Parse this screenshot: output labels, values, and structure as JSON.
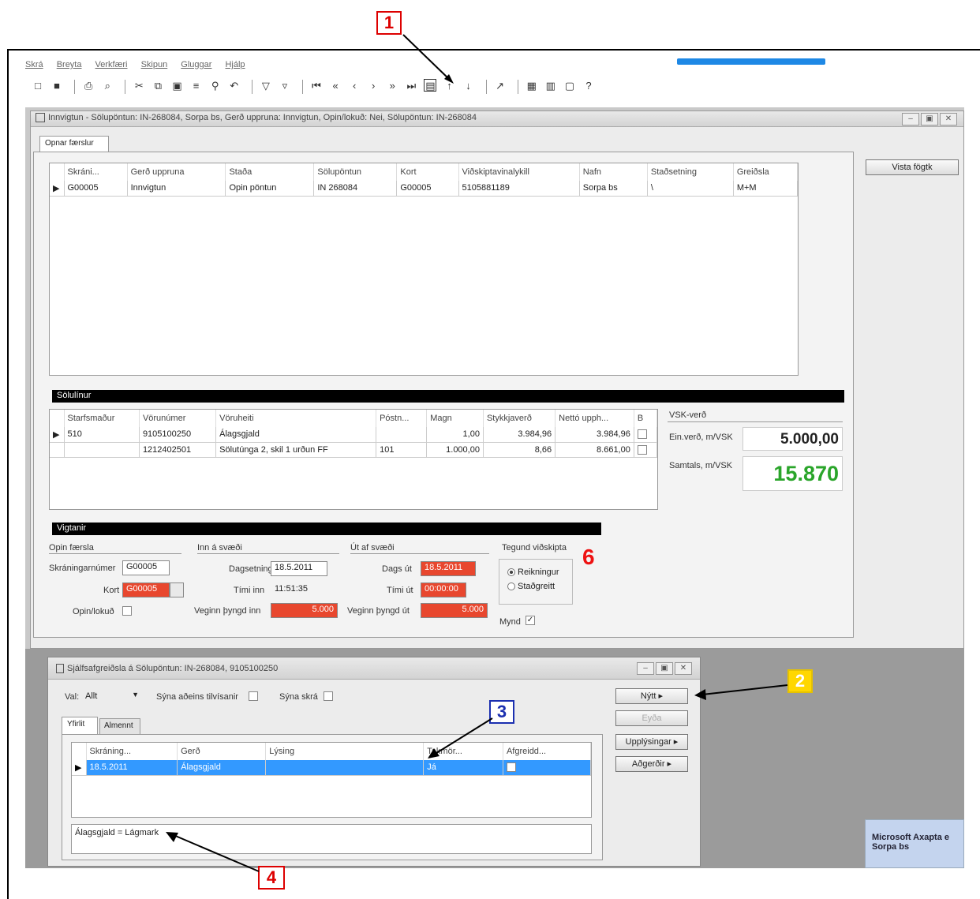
{
  "callouts": {
    "c1": "1",
    "c2": "2",
    "c3": "3",
    "c4": "4",
    "c6": "6"
  },
  "menu": [
    "Skrá",
    "Breyta",
    "Verkfæri",
    "Skipun",
    "Gluggar",
    "Hjálp"
  ],
  "main_window": {
    "title": "Innvigtun - Sölupöntun: IN-268084, Sorpa bs, Gerð uppruna: Innvigtun, Opin/lokuð: Nei, Sölupöntun: IN-268084",
    "tab": "Opnar færslur",
    "side_button": "Vista fögtk",
    "orders": {
      "headers": [
        "Skráni...",
        "Gerð uppruna",
        "Staða",
        "Sölupöntun",
        "Kort",
        "Viðskiptavinalykill",
        "Nafn",
        "Staðsetning",
        "Greiðsla"
      ],
      "rows": [
        [
          "G00005",
          "Innvigtun",
          "Opin pöntun",
          "IN 268084",
          "G00005",
          "5105881189",
          "Sorpa bs",
          "\\",
          "M+M"
        ]
      ]
    },
    "lines_section": {
      "title": "Sölulínur",
      "headers": [
        "Starfsmaður",
        "Vörunúmer",
        "Vöruheiti",
        "Póstn...",
        "Magn",
        "Stykkjaverð",
        "Nettó upph...",
        "B"
      ],
      "rows": [
        [
          "510",
          "9105100250",
          "Álagsgjald",
          "",
          "1,00",
          "3.984,96",
          "3.984,96"
        ],
        [
          "",
          "1212402501",
          "Sölutúnga 2, skil 1 urðun FF",
          "101",
          "1.000,00",
          "8,66",
          "8.661,00"
        ]
      ],
      "vat_label": "VSK-verð",
      "unit_price_label": "Ein.verð, m/VSK",
      "unit_price": "5.000,00",
      "total_label": "Samtals, m/VSK",
      "total": "15.870"
    },
    "weighing": {
      "title": "Vigtanir",
      "g1_title": "Opin færsla",
      "license_label": "Skráningarnúmer",
      "license": "G00005",
      "card_label": "Kort",
      "card": "G00005",
      "open_label": "Opin/lokuð",
      "g2_title": "Inn á svæði",
      "date_in_label": "Dagsetning",
      "date_in": "18.5.2011",
      "time_in_label": "Tími inn",
      "time_in": "11:51:35",
      "weight_in_label": "Veginn þyngd inn",
      "weight_in": "5.000",
      "g3_title": "Út af svæði",
      "date_out_label": "Dags út",
      "date_out": "18.5.2011",
      "time_out_label": "Tími út",
      "time_out": "00:00:00",
      "weight_out_label": "Veginn þyngd út",
      "weight_out": "5.000",
      "g4_title": "Tegund viðskipta",
      "radio1": "Reikningur",
      "radio2": "Staðgreitt",
      "photo_label": "Mynd"
    }
  },
  "sub_window": {
    "title": "Sjálfsafgreiðsla á Sölupöntun: IN-268084, 9105100250",
    "view_label": "Val:",
    "view_value": "Allt",
    "show_active_label": "Sýna aðeins tilvísanir",
    "show_all_label": "Sýna skrá",
    "tabs": [
      "Yfirlit",
      "Almennt"
    ],
    "headers": [
      "Skráning...",
      "Gerð",
      "Lýsing",
      "Takmör...",
      "Afgreidd..."
    ],
    "row": [
      "18.5.2011",
      "Álagsgjald",
      "",
      "Já",
      ""
    ],
    "note": "Álagsgjald = Lágmark",
    "buttons": {
      "new": "Nýtt",
      "delete": "Eyða",
      "info": "Upplýsingar",
      "functions": "Aðgerðir"
    }
  },
  "toast": {
    "line1": "Microsoft Axapta e",
    "line2": "Sorpa bs"
  },
  "colors": {
    "red_field": "#e8472e",
    "total_green": "#2aa52a",
    "selected_row": "#3399ff"
  }
}
